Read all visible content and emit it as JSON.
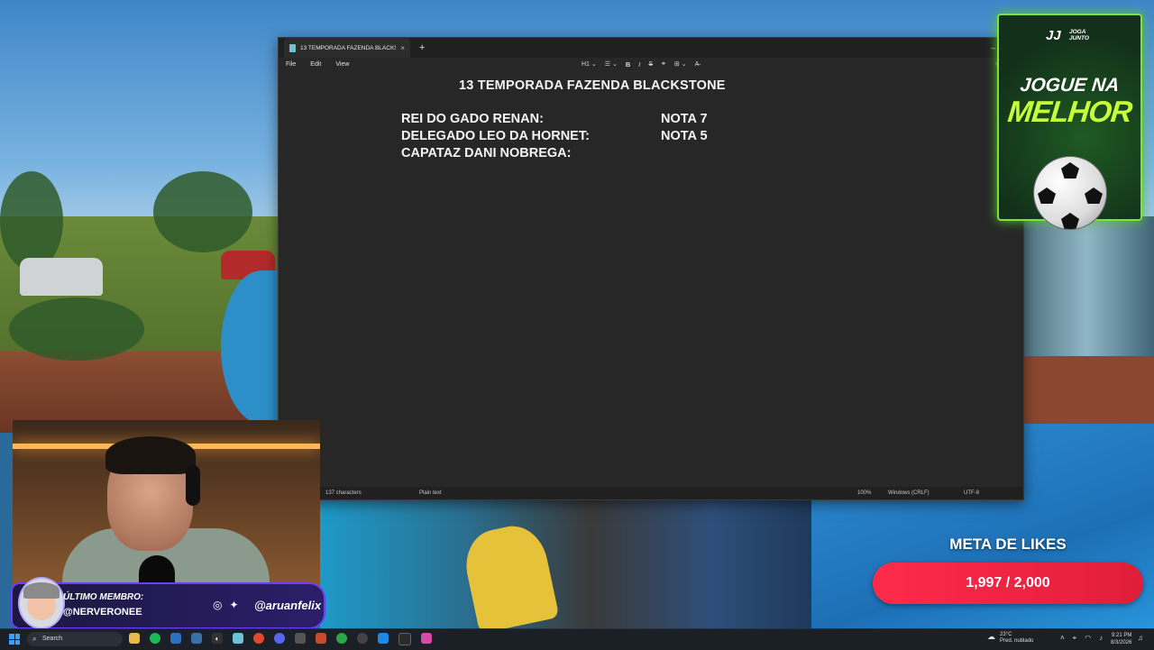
{
  "notepad": {
    "tab_title": "13 TEMPORADA FAZENDA BLACKS",
    "tab_close": "×",
    "new_tab": "+",
    "menu": [
      "File",
      "Edit",
      "View"
    ],
    "toolbar": {
      "heading": "H1 ⌄",
      "list": "☰ ⌄",
      "bold": "B",
      "italic": "I",
      "strikethrough": "S",
      "link": "⚭",
      "table": "⊞ ⌄",
      "clear": "A̶"
    },
    "document": {
      "title": "13 TEMPORADA FAZENDA BLACKSTONE",
      "rows": [
        {
          "label": "REI DO GADO RENAN:",
          "grade": "NOTA 7"
        },
        {
          "label": "DELEGADO LEO DA HORNET:",
          "grade": "NOTA 5"
        },
        {
          "label": "CAPATAZ DANI NOBREGA:",
          "grade": ""
        }
      ]
    },
    "status": {
      "characters": "137 characters",
      "format": "Plain text",
      "zoom": "100%",
      "line_ending": "Windows (CRLF)",
      "encoding": "UTF-8"
    }
  },
  "ad": {
    "logo_mark": "JJ",
    "logo_text_1": "JOGA",
    "logo_text_2": "JUNTO",
    "line1": "JOGUE NA",
    "line2": "MELHOR"
  },
  "member": {
    "label": "ÚLTIMO MEMBRO:",
    "name": "@NERVERONEE",
    "handle": "@aruanfelix"
  },
  "likes": {
    "title": "META DE LIKES",
    "progress": "1,997 / 2,000"
  },
  "taskbar": {
    "search_placeholder": "Search",
    "weather_temp": "23°C",
    "weather_desc": "Pred. nublado",
    "time": "9:21 PM",
    "date": "8/3/2026"
  },
  "colors": {
    "accent_green": "#7de23a",
    "likes_red": "#ff2a4a",
    "member_purple": "#6b3cff"
  }
}
